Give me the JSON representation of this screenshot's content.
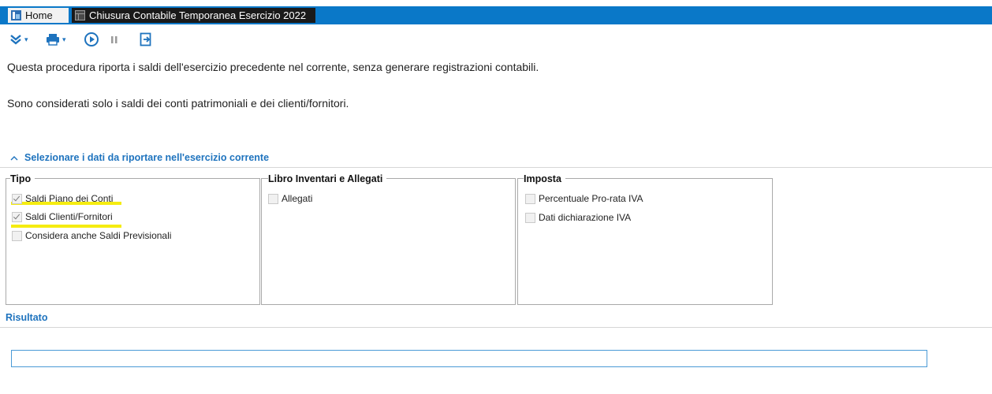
{
  "tabs": {
    "home": "Home",
    "active": "Chiusura Contabile Temporanea Esercizio 2022"
  },
  "toolbar": {
    "icons": [
      "expand-icon",
      "print-icon",
      "play-icon",
      "pause-icon",
      "exit-icon"
    ],
    "accent": "#1e73be"
  },
  "intro": {
    "line1": "Questa procedura riporta i saldi dell'esercizio precedente nel corrente, senza generare registrazioni contabili.",
    "line2": "Sono considerati solo i saldi dei conti patrimoniali e dei clienti/fornitori."
  },
  "section": {
    "title": "Selezionare i dati da riportare nell'esercizio corrente"
  },
  "groups": {
    "tipo": {
      "title": "Tipo",
      "items": [
        {
          "label": "Saldi Piano dei Conti",
          "checked": true
        },
        {
          "label": "Saldi Clienti/Fornitori",
          "checked": true
        },
        {
          "label": "Considera anche Saldi Previsionali",
          "checked": false
        }
      ]
    },
    "libro": {
      "title": "Libro Inventari e Allegati",
      "items": [
        {
          "label": "Allegati",
          "checked": false
        }
      ]
    },
    "imposta": {
      "title": "Imposta",
      "items": [
        {
          "label": "Percentuale Pro-rata IVA",
          "checked": false
        },
        {
          "label": "Dati dichiarazione IVA",
          "checked": false
        }
      ]
    }
  },
  "result": {
    "title": "Risultato",
    "value": ""
  },
  "colors": {
    "tabbar": "#0a78c8",
    "highlight": "#f5ec10",
    "link": "#1e73be"
  }
}
